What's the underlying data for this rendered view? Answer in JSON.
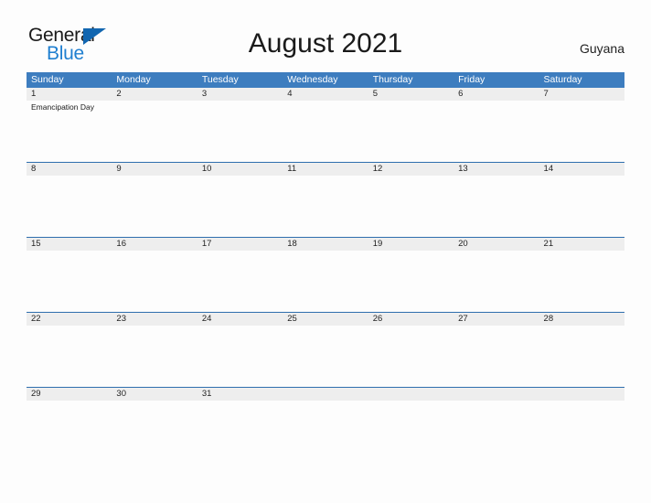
{
  "brand": {
    "name_part1": "General",
    "name_part2": "Blue",
    "triangle_color": "#1266b0",
    "blue_color": "#1f7fd0"
  },
  "header": {
    "title": "August 2021",
    "country": "Guyana"
  },
  "theme": {
    "header_blue": "#3d7dbf",
    "row_separator_blue": "#2f6fae",
    "daynum_band_gray": "#eeeeee",
    "page_background": "#fdfdfd",
    "text_dark": "#222222"
  },
  "calendar": {
    "weekdays": [
      "Sunday",
      "Monday",
      "Tuesday",
      "Wednesday",
      "Thursday",
      "Friday",
      "Saturday"
    ],
    "weeks": [
      {
        "days": [
          {
            "num": "1",
            "event": "Emancipation Day"
          },
          {
            "num": "2",
            "event": ""
          },
          {
            "num": "3",
            "event": ""
          },
          {
            "num": "4",
            "event": ""
          },
          {
            "num": "5",
            "event": ""
          },
          {
            "num": "6",
            "event": ""
          },
          {
            "num": "7",
            "event": ""
          }
        ]
      },
      {
        "days": [
          {
            "num": "8",
            "event": ""
          },
          {
            "num": "9",
            "event": ""
          },
          {
            "num": "10",
            "event": ""
          },
          {
            "num": "11",
            "event": ""
          },
          {
            "num": "12",
            "event": ""
          },
          {
            "num": "13",
            "event": ""
          },
          {
            "num": "14",
            "event": ""
          }
        ]
      },
      {
        "days": [
          {
            "num": "15",
            "event": ""
          },
          {
            "num": "16",
            "event": ""
          },
          {
            "num": "17",
            "event": ""
          },
          {
            "num": "18",
            "event": ""
          },
          {
            "num": "19",
            "event": ""
          },
          {
            "num": "20",
            "event": ""
          },
          {
            "num": "21",
            "event": ""
          }
        ]
      },
      {
        "days": [
          {
            "num": "22",
            "event": ""
          },
          {
            "num": "23",
            "event": ""
          },
          {
            "num": "24",
            "event": ""
          },
          {
            "num": "25",
            "event": ""
          },
          {
            "num": "26",
            "event": ""
          },
          {
            "num": "27",
            "event": ""
          },
          {
            "num": "28",
            "event": ""
          }
        ]
      },
      {
        "days": [
          {
            "num": "29",
            "event": ""
          },
          {
            "num": "30",
            "event": ""
          },
          {
            "num": "31",
            "event": ""
          },
          {
            "num": "",
            "event": ""
          },
          {
            "num": "",
            "event": ""
          },
          {
            "num": "",
            "event": ""
          },
          {
            "num": "",
            "event": ""
          }
        ]
      }
    ]
  }
}
